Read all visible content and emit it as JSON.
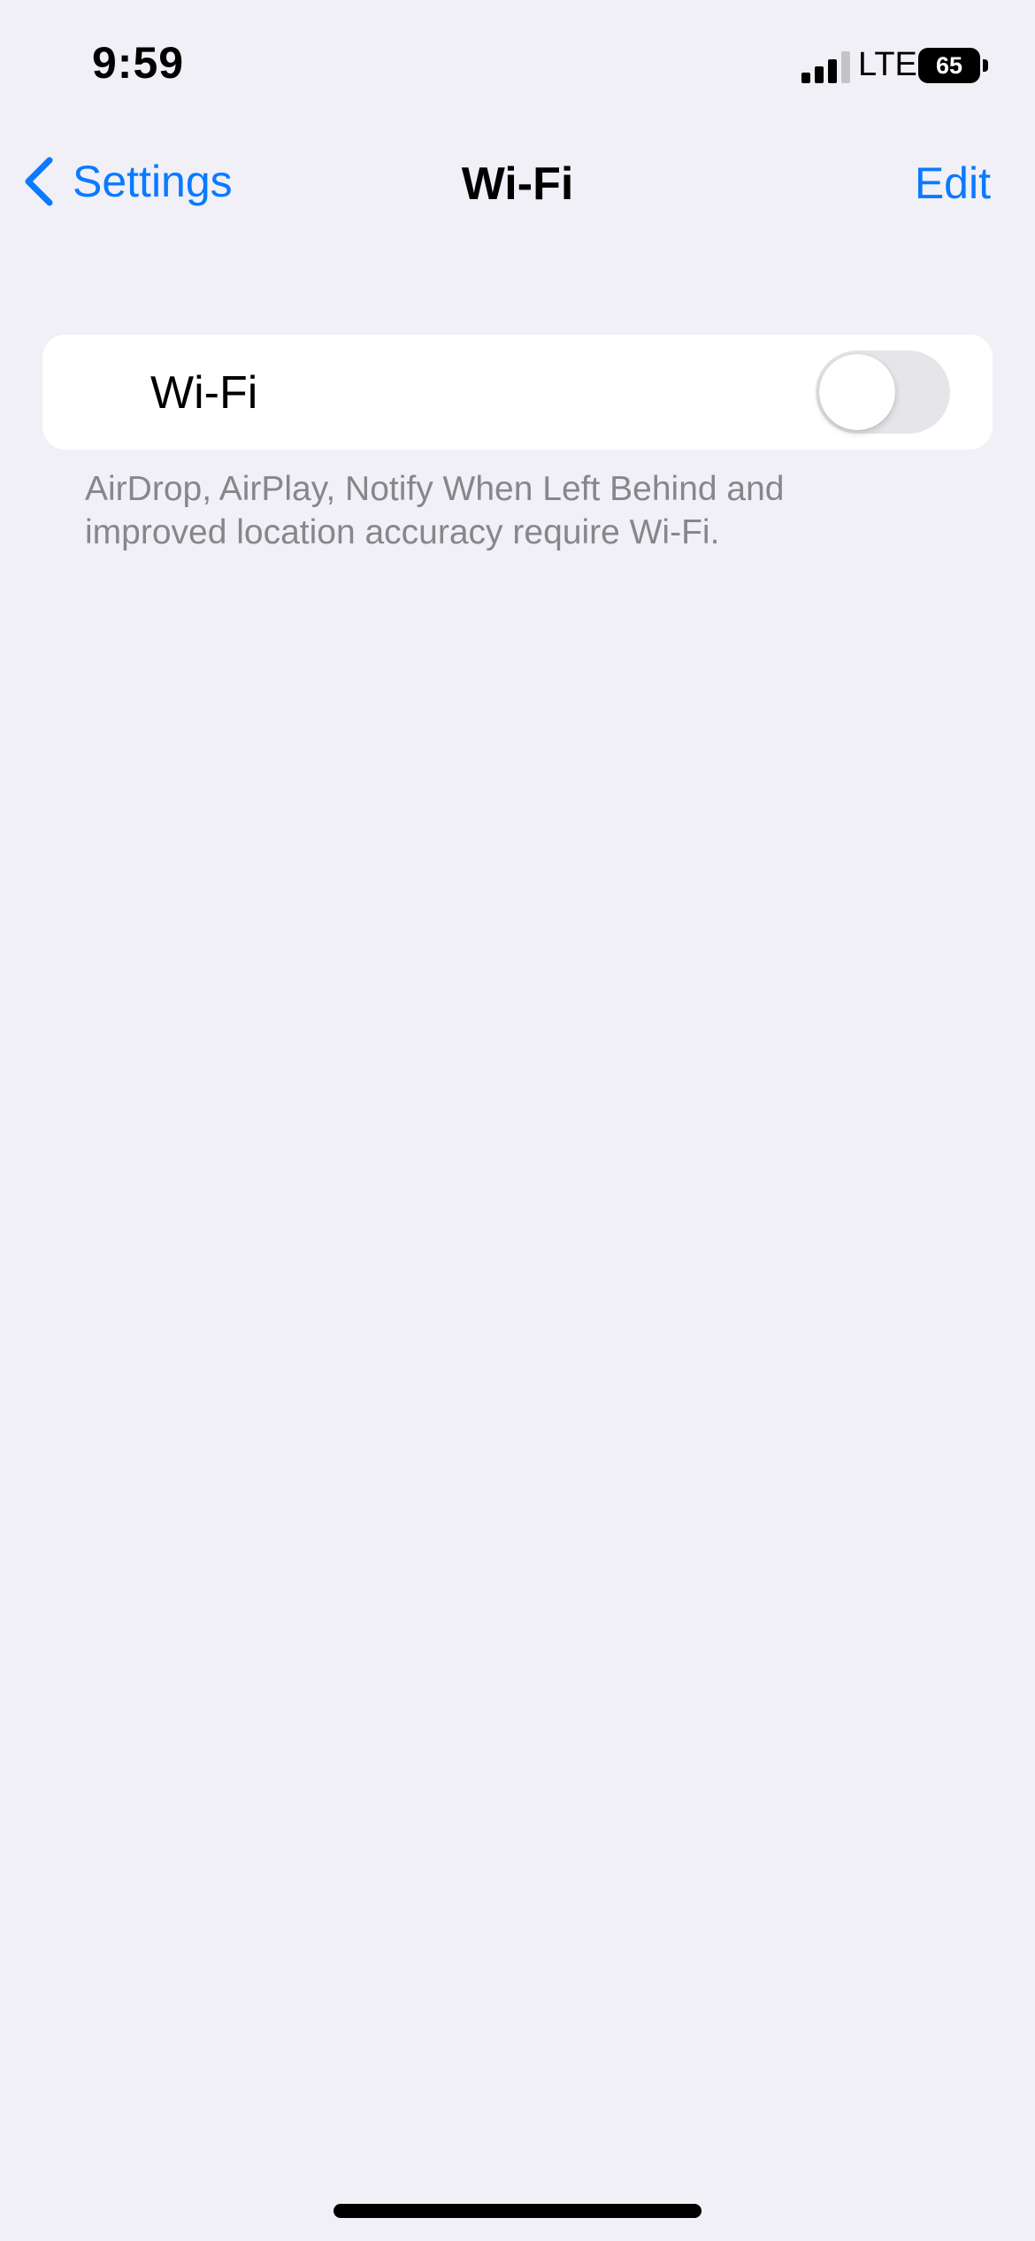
{
  "status_bar": {
    "time": "9:59",
    "network": "LTE",
    "battery": "65",
    "signal_icon": "cellular-signal-icon",
    "battery_icon": "battery-icon"
  },
  "nav": {
    "back_label": "Settings",
    "back_icon": "chevron-left-icon",
    "title": "Wi-Fi",
    "edit_label": "Edit"
  },
  "wifi": {
    "label": "Wi-Fi",
    "toggle_on": false,
    "footer": "AirDrop, AirPlay, Notify When Left Behind and improved location accuracy require Wi-Fi."
  },
  "colors": {
    "background": "#f0f0f6",
    "accent": "#0a7aff",
    "toggle_off": "#e6e6ea",
    "footer_text": "#86868b"
  }
}
